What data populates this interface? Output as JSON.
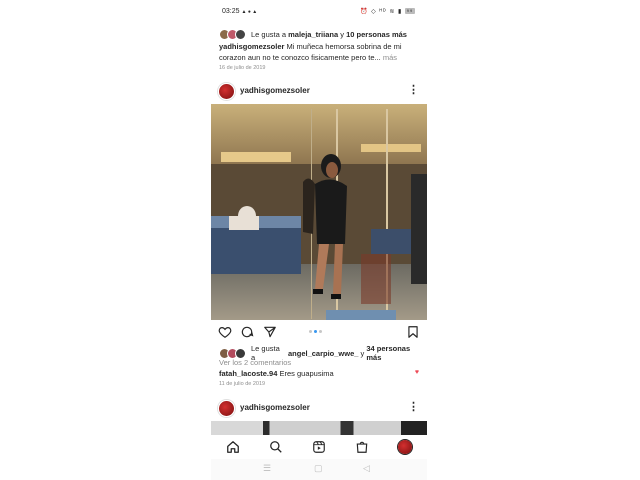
{
  "status": {
    "time": "03:25",
    "time_icons": "▲ ● ▲",
    "right_icons": "⏰ ◇ ᴴᴰ ≋ ▮",
    "battery": "99"
  },
  "colors": {
    "accent": "#3897f0",
    "like": "#ed4956",
    "muted": "#8e8e8e",
    "text": "#262626"
  },
  "prev_post": {
    "likes_prefix": "Le gusta a",
    "likes_user": "maleja_triiana",
    "likes_join": "y",
    "likes_others": "10 personas más",
    "caption_user": "yadhisgomezsoler",
    "caption_text": "Mi muñeca hemorsa sobrina de mi corazon aun no te conozco fisicamente pero te...",
    "more": "más",
    "date": "16 de julio de 2019"
  },
  "post": {
    "username": "yadhisgomezsoler",
    "menu_icon": "kebab-icon",
    "likes_prefix": "Le gusta a",
    "likes_user": "angel_carpio_wwe_",
    "likes_join": "y",
    "likes_others": "34 personas más",
    "view_comments": "Ver los 2 comentarios",
    "comment_user": "fatah_lacoste.94",
    "comment_text": "Eres guapusima",
    "date": "11 de julio de 2019",
    "carousel": {
      "count": 3,
      "active": 1
    }
  },
  "next_post": {
    "username": "yadhisgomezsoler"
  },
  "tabs": [
    "home-icon",
    "search-icon",
    "reels-icon",
    "shop-icon",
    "profile-avatar"
  ],
  "nav": [
    "menu-icon",
    "home-square-icon",
    "back-icon"
  ]
}
